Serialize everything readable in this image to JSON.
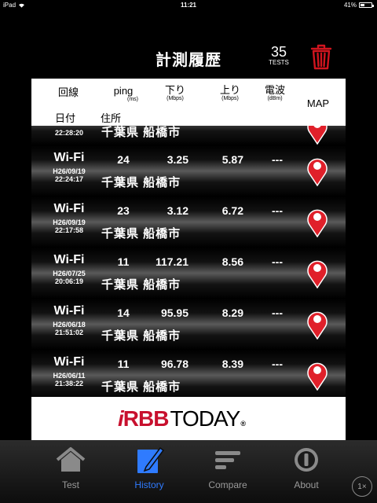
{
  "statusbar": {
    "device": "iPad",
    "time": "11:21",
    "battery": "41%",
    "battery_level": 0.41
  },
  "header": {
    "title": "計測履歴",
    "tests_count": "35",
    "tests_label": "TESTS"
  },
  "table": {
    "headers": {
      "carrier": "回線",
      "ping": "ping",
      "ping_unit": "(ms)",
      "down": "下り",
      "down_unit": "(Mbps)",
      "up": "上り",
      "up_unit": "(Mbps)",
      "signal": "電波",
      "signal_unit": "(dBm)",
      "date": "日付",
      "address": "住所",
      "map": "MAP"
    },
    "partial_row": {
      "time": "22:28:20",
      "address": "千葉県 船橋市"
    },
    "rows": [
      {
        "carrier": "Wi-Fi",
        "ping": "24",
        "down": "3.25",
        "up": "5.87",
        "signal": "---",
        "date": "H26/09/19",
        "time": "22:24:17",
        "address": "千葉県 船橋市"
      },
      {
        "carrier": "Wi-Fi",
        "ping": "23",
        "down": "3.12",
        "up": "6.72",
        "signal": "---",
        "date": "H26/09/19",
        "time": "22:17:58",
        "address": "千葉県 船橋市"
      },
      {
        "carrier": "Wi-Fi",
        "ping": "11",
        "down": "117.21",
        "up": "8.56",
        "signal": "---",
        "date": "H26/07/25",
        "time": "20:06:19",
        "address": "千葉県 船橋市"
      },
      {
        "carrier": "Wi-Fi",
        "ping": "14",
        "down": "95.95",
        "up": "8.29",
        "signal": "---",
        "date": "H26/06/18",
        "time": "21:51:02",
        "address": "千葉県 船橋市"
      },
      {
        "carrier": "Wi-Fi",
        "ping": "11",
        "down": "96.78",
        "up": "8.39",
        "signal": "---",
        "date": "H26/06/11",
        "time": "21:38:22",
        "address": "千葉県 船橋市"
      }
    ]
  },
  "footer": {
    "brand_i": "i",
    "brand_bb": "RBB",
    "brand_today": "TODAY",
    "brand_reg": "®"
  },
  "tabbar": {
    "tabs": [
      {
        "label": "Test",
        "icon": "house-icon"
      },
      {
        "label": "History",
        "icon": "pencil-note-icon",
        "active": true
      },
      {
        "label": "Compare",
        "icon": "bars-icon"
      },
      {
        "label": "About",
        "icon": "info-circle-icon"
      }
    ]
  },
  "zoom_label": "1×",
  "colors": {
    "accent_blue": "#2f7bff",
    "pin_red": "#e0202a",
    "trash_red": "#d0141e",
    "brand_red": "#c8102e"
  }
}
